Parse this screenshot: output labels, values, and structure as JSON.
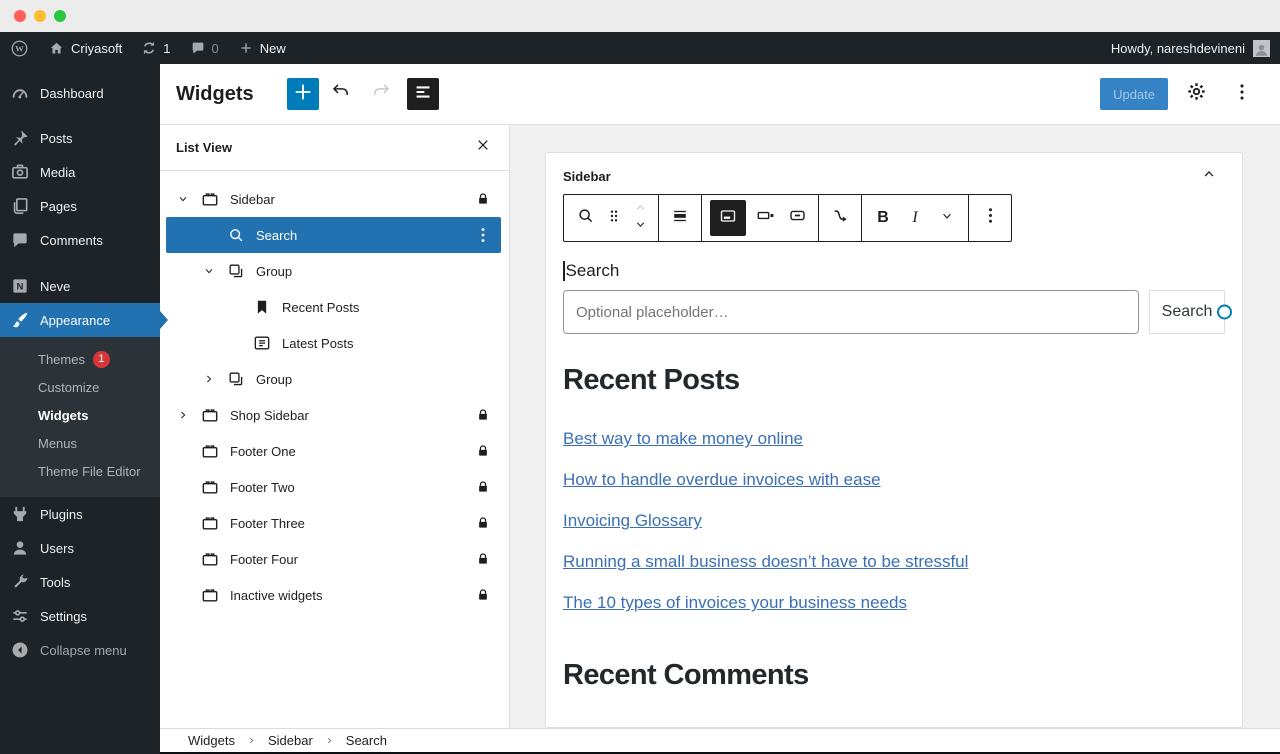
{
  "admin_bar": {
    "site_name": "Criyasoft",
    "update_count": "1",
    "comment_count": "0",
    "new_label": "New",
    "howdy": "Howdy, nareshdevineni"
  },
  "side_menu": {
    "items": [
      {
        "label": "Dashboard",
        "icon": "dashboard-icon",
        "gap_before": false
      },
      {
        "label": "Posts",
        "icon": "posts-icon",
        "gap_before": true
      },
      {
        "label": "Media",
        "icon": "media-icon",
        "gap_before": false
      },
      {
        "label": "Pages",
        "icon": "pages-icon",
        "gap_before": false
      },
      {
        "label": "Comments",
        "icon": "comments-icon",
        "gap_before": false
      },
      {
        "label": "Neve",
        "icon": "neve-icon",
        "gap_before": true
      },
      {
        "label": "Appearance",
        "icon": "appearance-icon",
        "active": true,
        "submenu": [
          {
            "label": "Themes",
            "badge": "1"
          },
          {
            "label": "Customize"
          },
          {
            "label": "Widgets",
            "current": true
          },
          {
            "label": "Menus"
          },
          {
            "label": "Theme File Editor"
          }
        ]
      },
      {
        "label": "Plugins",
        "icon": "plugins-icon",
        "gap_before": false
      },
      {
        "label": "Users",
        "icon": "users-icon",
        "gap_before": false
      },
      {
        "label": "Tools",
        "icon": "tools-icon",
        "gap_before": false
      },
      {
        "label": "Settings",
        "icon": "settings-icon",
        "gap_before": false
      },
      {
        "label": "Collapse menu",
        "icon": "collapse-icon",
        "muted": true,
        "gap_before": false
      }
    ]
  },
  "editor_header": {
    "title": "Widgets",
    "update_label": "Update"
  },
  "list_view": {
    "title": "List View",
    "items": [
      {
        "label": "Sidebar",
        "icon": "widget-area-icon",
        "level": 0,
        "expander": "down",
        "locked": true
      },
      {
        "label": "Search",
        "icon": "search-icon",
        "level": 1,
        "selected": true,
        "menu": true
      },
      {
        "label": "Group",
        "icon": "group-icon",
        "level": 1,
        "expander": "down"
      },
      {
        "label": "Recent Posts",
        "icon": "bookmark-icon",
        "level": 2
      },
      {
        "label": "Latest Posts",
        "icon": "list-icon",
        "level": 2
      },
      {
        "label": "Group",
        "icon": "group-icon",
        "level": 1,
        "expander": "right"
      },
      {
        "label": "Shop Sidebar",
        "icon": "widget-area-icon",
        "level": 0,
        "expander": "right",
        "locked": true
      },
      {
        "label": "Footer One",
        "icon": "widget-area-icon",
        "level": 0,
        "locked": true
      },
      {
        "label": "Footer Two",
        "icon": "widget-area-icon",
        "level": 0,
        "locked": true
      },
      {
        "label": "Footer Three",
        "icon": "widget-area-icon",
        "level": 0,
        "locked": true
      },
      {
        "label": "Footer Four",
        "icon": "widget-area-icon",
        "level": 0,
        "locked": true
      },
      {
        "label": "Inactive widgets",
        "icon": "widget-area-icon",
        "level": 0,
        "locked": true
      }
    ]
  },
  "widget_area": {
    "title": "Sidebar"
  },
  "toolbar": {
    "bold": "B",
    "italic": "I"
  },
  "search_block": {
    "label": "Search",
    "placeholder": "Optional placeholder…",
    "button": "Search"
  },
  "recent_posts": {
    "title": "Recent Posts",
    "links": [
      "Best way to make money online",
      "How to handle overdue invoices with ease",
      "Invoicing Glossary",
      "Running a small business doesn’t have to be stressful",
      "The 10 types of invoices your business needs"
    ]
  },
  "recent_comments": {
    "title": "Recent Comments"
  },
  "breadcrumb": {
    "items": [
      "Widgets",
      "Sidebar",
      "Search"
    ]
  },
  "colors": {
    "accent": "#2271b1",
    "primary": "#007cba",
    "update_button": "#3582c4",
    "link": "#3a6fb5",
    "badge": "#d63638",
    "admin_dark": "#1d2327",
    "submenu_dark": "#2c3338"
  }
}
